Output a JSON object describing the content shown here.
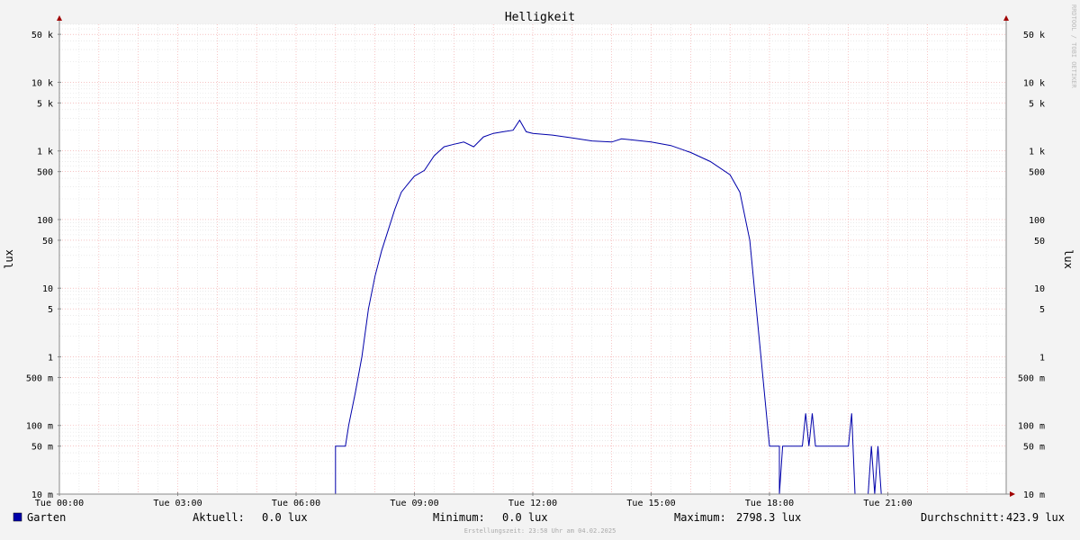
{
  "watermark": "RRDTOOL / TOBI OETIKER",
  "chart_data": {
    "type": "line",
    "title": "Helligkeit",
    "ylabel": "lux",
    "yscale": "log",
    "ylim": [
      0.01,
      70000
    ],
    "y_ticks": [
      {
        "v": 50000,
        "label": "50 k"
      },
      {
        "v": 10000,
        "label": "10 k"
      },
      {
        "v": 5000,
        "label": "5 k"
      },
      {
        "v": 1000,
        "label": "1 k"
      },
      {
        "v": 500,
        "label": "500"
      },
      {
        "v": 100,
        "label": "100"
      },
      {
        "v": 50,
        "label": "50"
      },
      {
        "v": 10,
        "label": "10"
      },
      {
        "v": 5,
        "label": "5"
      },
      {
        "v": 1,
        "label": "1"
      },
      {
        "v": 0.5,
        "label": "500 m"
      },
      {
        "v": 0.1,
        "label": "100 m"
      },
      {
        "v": 0.05,
        "label": "50 m"
      },
      {
        "v": 0.01,
        "label": "10 m"
      }
    ],
    "xlim": [
      "00:00",
      "24:00"
    ],
    "x_ticks": [
      {
        "t": "00:00",
        "label": "Tue 00:00"
      },
      {
        "t": "03:00",
        "label": "Tue 03:00"
      },
      {
        "t": "06:00",
        "label": "Tue 06:00"
      },
      {
        "t": "09:00",
        "label": "Tue 09:00"
      },
      {
        "t": "12:00",
        "label": "Tue 12:00"
      },
      {
        "t": "15:00",
        "label": "Tue 15:00"
      },
      {
        "t": "18:00",
        "label": "Tue 18:00"
      },
      {
        "t": "21:00",
        "label": "Tue 21:00"
      }
    ],
    "grid": true,
    "series": [
      {
        "name": "Garten",
        "color": "#0000aa",
        "points": [
          [
            "00:00",
            0.01
          ],
          [
            "07:00",
            0.01
          ],
          [
            "07:00",
            0.05
          ],
          [
            "07:15",
            0.05
          ],
          [
            "07:20",
            0.1
          ],
          [
            "07:30",
            0.3
          ],
          [
            "07:40",
            1.0
          ],
          [
            "07:50",
            5
          ],
          [
            "08:00",
            15
          ],
          [
            "08:10",
            35
          ],
          [
            "08:20",
            70
          ],
          [
            "08:30",
            140
          ],
          [
            "08:40",
            250
          ],
          [
            "08:50",
            330
          ],
          [
            "09:00",
            430
          ],
          [
            "09:15",
            520
          ],
          [
            "09:30",
            850
          ],
          [
            "09:45",
            1150
          ],
          [
            "10:00",
            1250
          ],
          [
            "10:15",
            1350
          ],
          [
            "10:30",
            1150
          ],
          [
            "10:45",
            1600
          ],
          [
            "11:00",
            1800
          ],
          [
            "11:15",
            1900
          ],
          [
            "11:30",
            2000
          ],
          [
            "11:40",
            2800
          ],
          [
            "11:50",
            1900
          ],
          [
            "12:00",
            1800
          ],
          [
            "12:30",
            1700
          ],
          [
            "13:00",
            1550
          ],
          [
            "13:30",
            1400
          ],
          [
            "14:00",
            1350
          ],
          [
            "14:15",
            1500
          ],
          [
            "14:30",
            1450
          ],
          [
            "15:00",
            1350
          ],
          [
            "15:30",
            1200
          ],
          [
            "16:00",
            950
          ],
          [
            "16:30",
            700
          ],
          [
            "17:00",
            450
          ],
          [
            "17:15",
            250
          ],
          [
            "17:30",
            50
          ],
          [
            "17:40",
            5
          ],
          [
            "17:50",
            0.5
          ],
          [
            "18:00",
            0.05
          ],
          [
            "18:15",
            0.05
          ],
          [
            "18:15",
            0.01
          ],
          [
            "18:20",
            0.05
          ],
          [
            "18:50",
            0.05
          ],
          [
            "18:55",
            0.15
          ],
          [
            "19:00",
            0.05
          ],
          [
            "19:05",
            0.15
          ],
          [
            "19:10",
            0.05
          ],
          [
            "20:00",
            0.05
          ],
          [
            "20:05",
            0.15
          ],
          [
            "20:10",
            0.01
          ],
          [
            "20:30",
            0.01
          ],
          [
            "20:35",
            0.05
          ],
          [
            "20:40",
            0.01
          ],
          [
            "20:45",
            0.05
          ],
          [
            "20:50",
            0.01
          ],
          [
            "24:00",
            0.01
          ]
        ]
      }
    ]
  },
  "legend": {
    "series_name": "Garten",
    "current_label": "Aktuell:",
    "current_value": "0.0 lux",
    "min_label": "Minimum:",
    "min_value": "0.0 lux",
    "max_label": "Maximum:",
    "max_value": "2798.3 lux",
    "avg_label": "Durchschnitt:",
    "avg_value": "423.9 lux",
    "footer": "Erstellungszeit: 23:58 Uhr am 04.02.2025"
  }
}
